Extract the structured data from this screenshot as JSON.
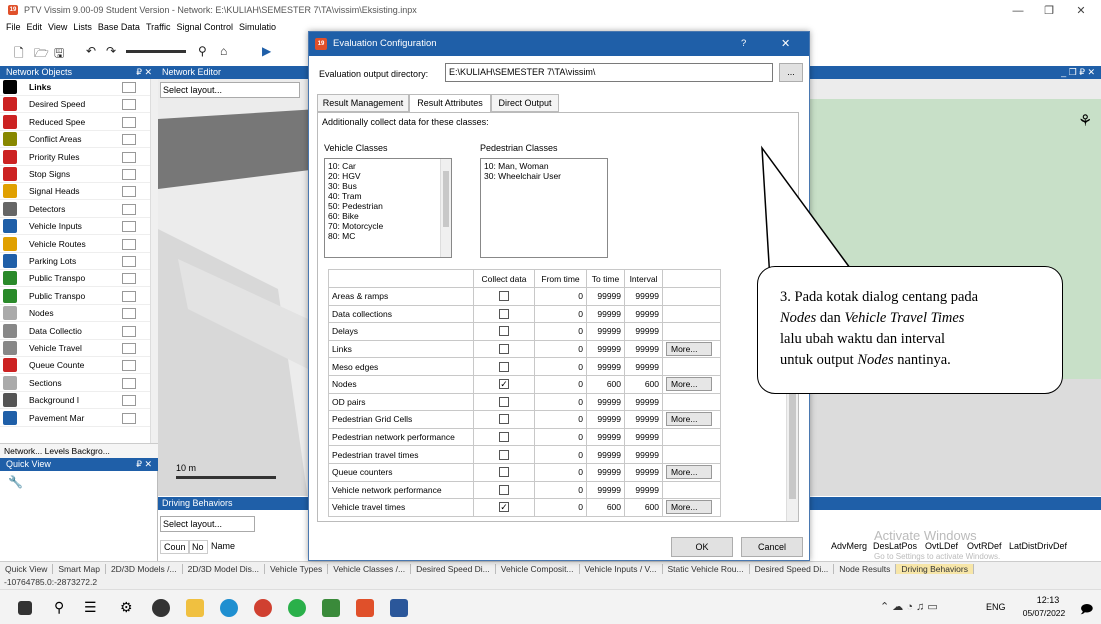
{
  "window": {
    "title": "PTV Vissim 9.00-09 Student Version - Network: E:\\KULIAH\\SEMESTER 7\\TA\\vissim\\Eksisting.inpx",
    "app_icon": "19",
    "min": "—",
    "max": "❐",
    "close": "✕"
  },
  "menu": [
    "File",
    "Edit",
    "View",
    "Lists",
    "Base Data",
    "Traffic",
    "Signal Control",
    "Simulatio"
  ],
  "network_objects": {
    "title": "Network Objects",
    "pin": "₽ ✕",
    "items": [
      {
        "label": "Links",
        "icon": "links-icon",
        "color": "#000000",
        "bold": true
      },
      {
        "label": "Desired Speed",
        "icon": "speed-icon",
        "color": "#cc2222"
      },
      {
        "label": "Reduced Spee",
        "icon": "reduced-speed-icon",
        "color": "#cc2222"
      },
      {
        "label": "Conflict Areas",
        "icon": "conflict-icon",
        "color": "#888800"
      },
      {
        "label": "Priority Rules",
        "icon": "priority-icon",
        "color": "#cc2222"
      },
      {
        "label": "Stop Signs",
        "icon": "stop-icon",
        "color": "#cc2222"
      },
      {
        "label": "Signal Heads",
        "icon": "signal-icon",
        "color": "#e0a000"
      },
      {
        "label": "Detectors",
        "icon": "detector-icon",
        "color": "#666666"
      },
      {
        "label": "Vehicle Inputs",
        "icon": "vehicle-input-icon",
        "color": "#1f5fa8"
      },
      {
        "label": "Vehicle Routes",
        "icon": "route-icon",
        "color": "#e0a000"
      },
      {
        "label": "Parking Lots",
        "icon": "parking-icon",
        "color": "#1f5fa8"
      },
      {
        "label": "Public Transpo",
        "icon": "pt-stop-icon",
        "color": "#2a8a2a"
      },
      {
        "label": "Public Transpo",
        "icon": "pt-line-icon",
        "color": "#2a8a2a"
      },
      {
        "label": "Nodes",
        "icon": "nodes-icon",
        "color": "#aaaaaa"
      },
      {
        "label": "Data Collectio",
        "icon": "data-collection-icon",
        "color": "#888888"
      },
      {
        "label": "Vehicle Travel",
        "icon": "travel-time-icon",
        "color": "#888888"
      },
      {
        "label": "Queue Counte",
        "icon": "queue-icon",
        "color": "#cc2222"
      },
      {
        "label": "Sections",
        "icon": "sections-icon",
        "color": "#aaaaaa"
      },
      {
        "label": "Background I",
        "icon": "background-icon",
        "color": "#555555"
      },
      {
        "label": "Pavement Mar",
        "icon": "pavement-icon",
        "color": "#1f5fa8"
      }
    ],
    "tabs": "Network...  Levels  Backgro..."
  },
  "quick_view": {
    "title": "Quick View",
    "pin": "₽ ✕"
  },
  "network_editor": {
    "title": "Network Editor",
    "select_layout": "Select layout...",
    "scale": "10 m",
    "window_btns": "_ ❐ ₽ ✕"
  },
  "driving_behaviors": {
    "title": "Driving Behaviors",
    "select_layout": "Select layout...",
    "columns": [
      "Coun",
      "No",
      "Name"
    ],
    "right_columns": [
      "AdvMerg",
      "DesLatPos",
      "OvtLDef",
      "OvtRDef",
      "LatDistDrivDef"
    ],
    "watermark": "Activate Windows",
    "watermark_sub": "Go to Settings to activate Windows."
  },
  "bottom_tabs": [
    "Quick View",
    "Smart Map",
    "2D/3D Models /...",
    "2D/3D Model Dis...",
    "Vehicle Types",
    "Vehicle Classes /...",
    "Desired Speed Di...",
    "Vehicle Composit...",
    "Vehicle Inputs / V...",
    "Static Vehicle Rou...",
    "Desired Speed Di...",
    "Node Results",
    "Driving Behaviors"
  ],
  "coords": "-10764785.0:-2873272.2",
  "dialog": {
    "title": "Evaluation Configuration",
    "help": "?",
    "close": "✕",
    "dir_label": "Evaluation output directory:",
    "dir_value": "E:\\KULIAH\\SEMESTER 7\\TA\\vissim\\",
    "browse": "...",
    "tabs": [
      "Result Management",
      "Result Attributes",
      "Direct Output"
    ],
    "active_tab": 1,
    "note": "Additionally collect data for these classes:",
    "vehicle_classes_label": "Vehicle Classes",
    "vehicle_classes": [
      "10: Car",
      "20: HGV",
      "30: Bus",
      "40: Tram",
      "50: Pedestrian",
      "60: Bike",
      "70: Motorcycle",
      "80: MC"
    ],
    "pedestrian_classes_label": "Pedestrian Classes",
    "pedestrian_classes": [
      "10: Man, Woman",
      "30: Wheelchair User"
    ],
    "table": {
      "headers": [
        "",
        "Collect data",
        "From time",
        "To time",
        "Interval",
        ""
      ],
      "rows": [
        {
          "name": "Areas & ramps",
          "checked": false,
          "from": "0",
          "to": "99999",
          "interval": "99999",
          "more": ""
        },
        {
          "name": "Data collections",
          "checked": false,
          "from": "0",
          "to": "99999",
          "interval": "99999",
          "more": ""
        },
        {
          "name": "Delays",
          "checked": false,
          "from": "0",
          "to": "99999",
          "interval": "99999",
          "more": ""
        },
        {
          "name": "Links",
          "checked": false,
          "from": "0",
          "to": "99999",
          "interval": "99999",
          "more": "More..."
        },
        {
          "name": "Meso edges",
          "checked": false,
          "from": "0",
          "to": "99999",
          "interval": "99999",
          "more": ""
        },
        {
          "name": "Nodes",
          "checked": true,
          "from": "0",
          "to": "600",
          "interval": "600",
          "more": "More..."
        },
        {
          "name": "OD pairs",
          "checked": false,
          "from": "0",
          "to": "99999",
          "interval": "99999",
          "more": ""
        },
        {
          "name": "Pedestrian Grid Cells",
          "checked": false,
          "from": "0",
          "to": "99999",
          "interval": "99999",
          "more": "More..."
        },
        {
          "name": "Pedestrian network performance",
          "checked": false,
          "from": "0",
          "to": "99999",
          "interval": "99999",
          "more": ""
        },
        {
          "name": "Pedestrian travel times",
          "checked": false,
          "from": "0",
          "to": "99999",
          "interval": "99999",
          "more": ""
        },
        {
          "name": "Queue counters",
          "checked": false,
          "from": "0",
          "to": "99999",
          "interval": "99999",
          "more": "More..."
        },
        {
          "name": "Vehicle network performance",
          "checked": false,
          "from": "0",
          "to": "99999",
          "interval": "99999",
          "more": ""
        },
        {
          "name": "Vehicle travel times",
          "checked": true,
          "from": "0",
          "to": "600",
          "interval": "600",
          "more": "More..."
        }
      ]
    },
    "ok": "OK",
    "cancel": "Cancel"
  },
  "callout": {
    "line1": "3. Pada kotak dialog centang pada",
    "nodes": "Nodes",
    "dan": " dan ",
    "vtt": "Vehicle Travel Times",
    "line3": "lalu ubah waktu dan interval",
    "line4_pre": "untuk output ",
    "line4_nodes": "Nodes",
    "line4_post": " nantinya."
  },
  "taskbar": {
    "lang": "ENG",
    "time": "12:13",
    "date": "05/07/2022",
    "apps": [
      "windows-start-icon",
      "search-icon",
      "task-view-icon",
      "settings-icon",
      "github-icon",
      "file-explorer-icon",
      "edge-icon",
      "chrome-icon",
      "whatsapp-icon",
      "app-icon",
      "vissim-icon",
      "word-icon"
    ]
  }
}
